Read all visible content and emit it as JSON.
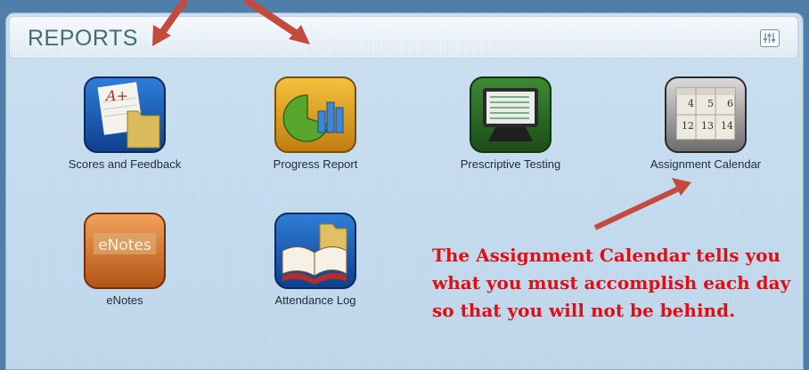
{
  "panel": {
    "title": "REPORTS",
    "settings_icon": "sliders-icon"
  },
  "tiles": [
    {
      "label": "Scores and Feedback",
      "icon": "scores-feedback-icon"
    },
    {
      "label": "Progress Report",
      "icon": "progress-chart-icon"
    },
    {
      "label": "Prescriptive Testing",
      "icon": "computer-monitor-icon"
    },
    {
      "label": "Assignment Calendar",
      "icon": "calendar-icon",
      "days": [
        "4",
        "5",
        "6",
        "12",
        "13",
        "14"
      ]
    },
    {
      "label": "eNotes",
      "icon": "enotes-icon",
      "icon_text": "eNotes"
    },
    {
      "label": "Attendance Log",
      "icon": "attendance-book-icon"
    }
  ],
  "scores_icon_text": "A+",
  "annotation": {
    "text": "The Assignment Calendar tells you what you must accomplish each day so that you will not be behind.",
    "color": "#e30e14"
  },
  "arrow_color": "#c54a3e"
}
